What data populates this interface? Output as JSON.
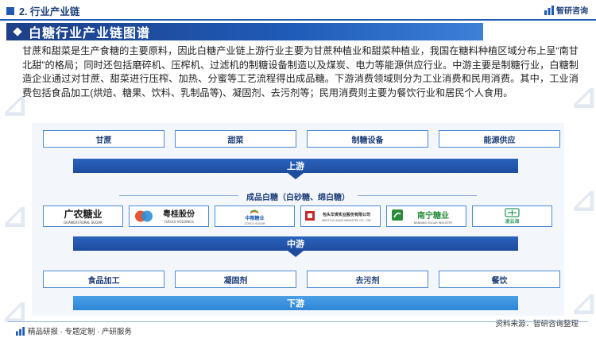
{
  "header": {
    "section_label": "2. 行业产业链",
    "brand_name": "智研咨询"
  },
  "title": "白糖行业产业链图谱",
  "paragraph": "甘蔗和甜菜是生产食糖的主要原料，因此白糖产业链上游行业主要为甘蔗种植业和甜菜种植业，我国在糖料种植区域分布上呈“南甘北甜”的格局；同时还包括磨碎机、压榨机、过滤机的制糖设备制造以及煤炭、电力等能源供应行业。中游主要是制糖行业，白糖制造企业通过对甘蔗、甜菜进行压榨、加热、分蜜等工艺流程得出成品糖。下游消费领域则分为工业消费和民用消费。其中，工业消费包括食品加工(烘焙、糖果、饮料、乳制品等)、凝固剂、去污剂等；民用消费则主要为餐饮行业和居民个人食用。",
  "diagram": {
    "upstream_items": [
      "甘蔗",
      "甜菜",
      "制糖设备",
      "能源供应"
    ],
    "upstream_label": "上游",
    "products_title": "成品白糖（白砂糖、绵白糖）",
    "companies": [
      {
        "name": "广农糖业",
        "sub": "GUANGXI RURAL SUGAR",
        "icon": "guangnong-logo"
      },
      {
        "name": "粤桂股份",
        "sub": "YUEGUI HOLDINGS",
        "icon": "yuegui-logo"
      },
      {
        "name": "中粮糖业",
        "sub": "COFCO SUGAR",
        "icon": "cofco-logo"
      },
      {
        "name": "包头华资实业股份有限公司",
        "sub": "BAOTOU HUAZI INDUSTRY CO., LTD",
        "icon": "huazi-logo"
      },
      {
        "name": "南宁糖业",
        "sub": "NANNING SUGAR INDUSTRY",
        "icon": "nanning-logo"
      },
      {
        "name": "凌云海",
        "sub": "",
        "icon": "lingyunhai-logo"
      }
    ],
    "midstream_label": "中游",
    "downstream_items": [
      "食品加工",
      "凝固剂",
      "去污剂",
      "餐饮"
    ],
    "downstream_label": "下游"
  },
  "footer": {
    "left": "精品研报 · 专题定制 · 产研服务",
    "right": "资料来源：智研咨询整理"
  },
  "colors": {
    "primary": "#1e5bb5",
    "dark_blue": "#1e3f88",
    "light_blue": "#4a9fe6",
    "panel_bg": "#f3f7fc"
  }
}
